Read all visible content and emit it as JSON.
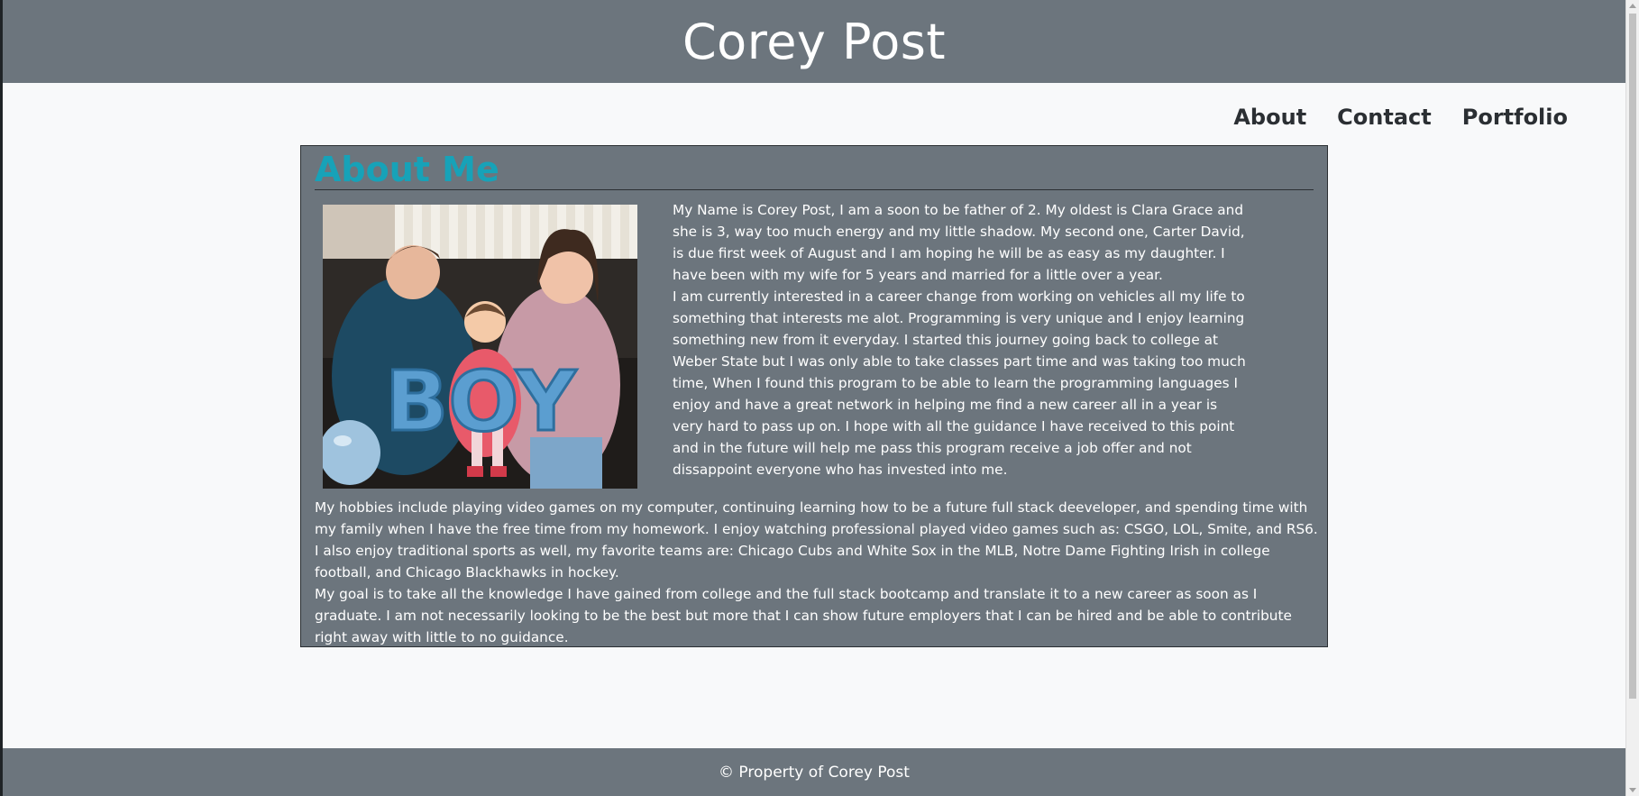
{
  "header": {
    "title": "Corey Post"
  },
  "nav": {
    "items": [
      {
        "label": "About"
      },
      {
        "label": "Contact"
      },
      {
        "label": "Portfolio"
      }
    ]
  },
  "about": {
    "title": "About Me",
    "bio_paragraphs": [
      "My Name is Corey Post, I am a soon to be father of 2. My oldest is Clara Grace and she is 3, way too much energy and my little shadow. My second one, Carter David, is due first week of August and I am hoping he will be as easy as my daughter. I have been with my wife for 5 years and married for a little over a year.",
      "I am currently interested in a career change from working on vehicles all my life to something that interests me alot. Programming is very unique and I enjoy learning something new from it everyday. I started this journey going back to college at Weber State but I was only able to take classes part time and was taking too much time, When I found this program to be able to learn the programming languages I enjoy and have a great network in helping me find a new career all in a year is very hard to pass up on. I hope with all the guidance I have received to this point and in the future will help me pass this program receive a job offer and not dissappoint everyone who has invested into me."
    ],
    "lower_paragraphs": [
      "My hobbies include playing video games on my computer, continuing learning how to be a future full stack deeveloper, and spending time with my family when I have the free time from my homework. I enjoy watching professional played video games such as: CSGO, LOL, Smite, and RS6. I also enjoy traditional sports as well, my favorite teams are: Chicago Cubs and White Sox in the MLB, Notre Dame Fighting Irish in college football, and Chicago Blackhawks in hockey.",
      "My goal is to take all the knowledge I have gained from college and the full stack bootcamp and translate it to a new career as soon as I graduate. I am not necessarily looking to be the best but more that I can show future employers that I can be hired and be able to contribute right away with little to no guidance."
    ],
    "photo_balloon_text": "BOY"
  },
  "footer": {
    "text": "© Property of Corey Post"
  },
  "colors": {
    "header_bg": "#6c757d",
    "page_bg": "#f8f9fa",
    "accent": "#17a2b8"
  }
}
